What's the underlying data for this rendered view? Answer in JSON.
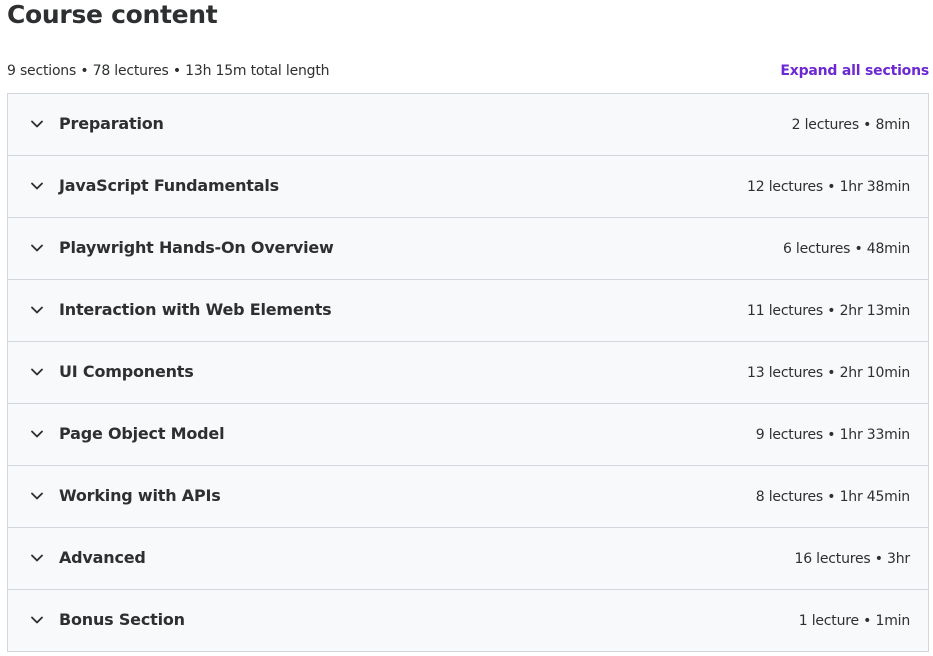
{
  "header": {
    "title": "Course content",
    "summary": "9 sections • 78 lectures • 13h 15m total length",
    "expand_all_label": "Expand all sections"
  },
  "colors": {
    "accent": "#6d28d2",
    "text": "#2d2f31",
    "row_bg": "#f7f9fa",
    "border": "#d1d7dc"
  },
  "sections": [
    {
      "title": "Preparation",
      "meta": "2 lectures • 8min",
      "icon": "chevron-down-icon"
    },
    {
      "title": "JavaScript Fundamentals",
      "meta": "12 lectures • 1hr 38min",
      "icon": "chevron-down-icon"
    },
    {
      "title": "Playwright Hands-On Overview",
      "meta": "6 lectures • 48min",
      "icon": "chevron-down-icon"
    },
    {
      "title": "Interaction with Web Elements",
      "meta": "11 lectures • 2hr 13min",
      "icon": "chevron-down-icon"
    },
    {
      "title": "UI Components",
      "meta": "13 lectures • 2hr 10min",
      "icon": "chevron-down-icon"
    },
    {
      "title": "Page Object Model",
      "meta": "9 lectures • 1hr 33min",
      "icon": "chevron-down-icon"
    },
    {
      "title": "Working with APIs",
      "meta": "8 lectures • 1hr 45min",
      "icon": "chevron-down-icon"
    },
    {
      "title": "Advanced",
      "meta": "16 lectures • 3hr",
      "icon": "chevron-down-icon"
    },
    {
      "title": "Bonus Section",
      "meta": "1 lecture • 1min",
      "icon": "chevron-down-icon"
    }
  ]
}
